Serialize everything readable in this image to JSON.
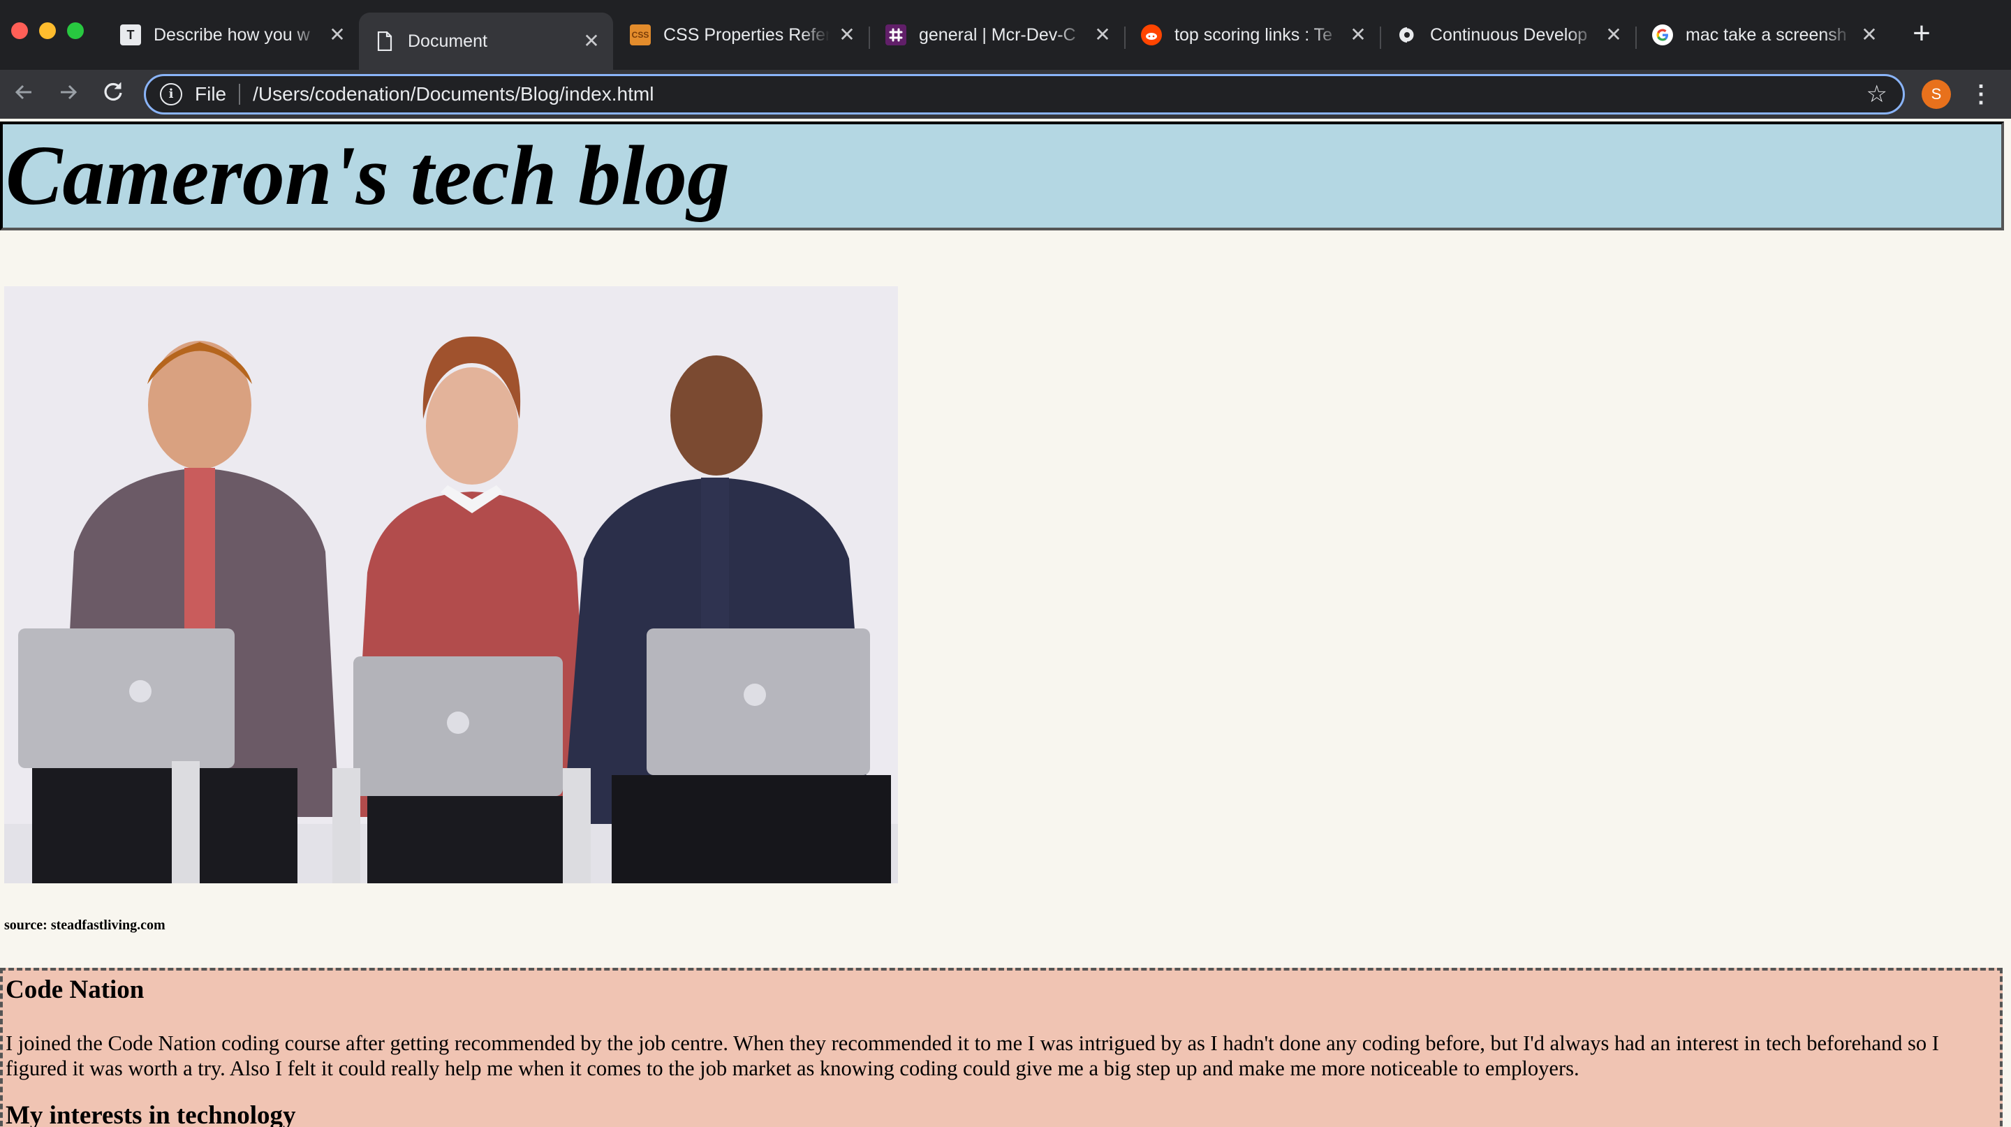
{
  "browser": {
    "tabs": [
      {
        "title": "Describe how you w",
        "favicon": "T",
        "favicon_color": "#e8eaed",
        "active": false
      },
      {
        "title": "Document",
        "favicon": "file-icon",
        "active": true
      },
      {
        "title": "CSS Properties Refer",
        "favicon": "CSS",
        "favicon_color": "#e38c2c",
        "active": false
      },
      {
        "title": "general | Mcr-Dev-C",
        "favicon": "slack-icon",
        "favicon_color": "#611f69",
        "active": false
      },
      {
        "title": "top scoring links : Te",
        "favicon": "reddit-icon",
        "favicon_color": "#ff4500",
        "active": false
      },
      {
        "title": "Continuous Develop",
        "favicon": "circleci-icon",
        "favicon_color": "#2c2c3c",
        "active": false
      },
      {
        "title": "mac take a screensh",
        "favicon": "google-icon",
        "favicon_color": "#ffffff",
        "active": false
      }
    ],
    "address_bar": {
      "scheme_label": "File",
      "url": "/Users/codenation/Documents/Blog/index.html"
    },
    "profile_initial": "S"
  },
  "page": {
    "header_title": "Cameron's tech blog",
    "image_caption": "source: steadfastliving.com",
    "section_heading": "Code Nation",
    "section_text": "I joined the Code Nation coding course after getting recommended by the job centre. When they recommended it to me I was intrigued by as I hadn't done any coding before, but I'd always had an interest in tech beforehand so I figured it was worth a try. Also I felt it could really help me when it comes to the job market as knowing coding could give me a big step up and make me more noticeable to employers.",
    "next_heading": "My interests in technology"
  },
  "colors": {
    "header_bg": "#b4d7e3",
    "section_bg": "#f0c4b3",
    "page_bg": "#f8f6ef",
    "chrome_dark": "#202124",
    "chrome_toolbar": "#35363a",
    "focus_ring": "#8ab4f8"
  }
}
